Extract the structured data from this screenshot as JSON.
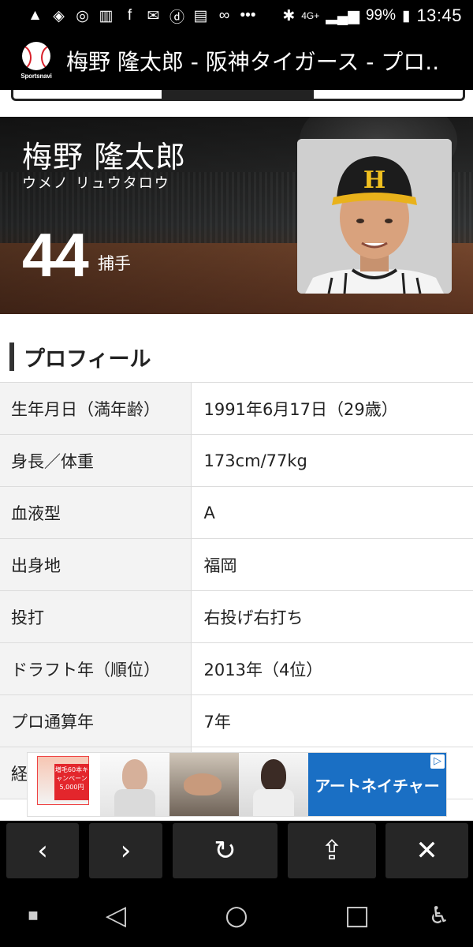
{
  "status_bar": {
    "left_icons": [
      "alert-icon",
      "app-icon",
      "wifi-app-icon",
      "book-icon",
      "facebook-icon",
      "mail-icon",
      "d-app-icon",
      "news-icon",
      "link-icon",
      "more-icon"
    ],
    "network": "4G+",
    "battery": "99%",
    "time": "13:45"
  },
  "browser": {
    "site_logo_text": "Sportsnavi",
    "page_title": "梅野 隆太郎 - 阪神タイガース - プロ.."
  },
  "player": {
    "name": "梅野 隆太郎",
    "kana": "ウメノ リュウタロウ",
    "number": "44",
    "position": "捕手"
  },
  "profile": {
    "title": "プロフィール",
    "rows": [
      {
        "label": "生年月日（満年齢）",
        "value": "1991年6月17日（29歳）"
      },
      {
        "label": "身長／体重",
        "value": "173cm/77kg"
      },
      {
        "label": "血液型",
        "value": "A"
      },
      {
        "label": "出身地",
        "value": "福岡"
      },
      {
        "label": "投打",
        "value": "右投げ右打ち"
      },
      {
        "label": "ドラフト年（順位）",
        "value": "2013年（4位）"
      },
      {
        "label": "プロ通算年",
        "value": "7年"
      },
      {
        "label": "経",
        "value": ""
      }
    ]
  },
  "ad": {
    "badge_text": "増毛60本キャンペーン5,000円",
    "brand": "アートネイチャー"
  },
  "toolbar": {
    "back": "‹",
    "forward": "›",
    "reload": "↻",
    "share": "⇪",
    "close": "✕"
  },
  "system_nav": {
    "back": "◁",
    "home": "○",
    "recents": "□",
    "accessibility": "♿"
  }
}
